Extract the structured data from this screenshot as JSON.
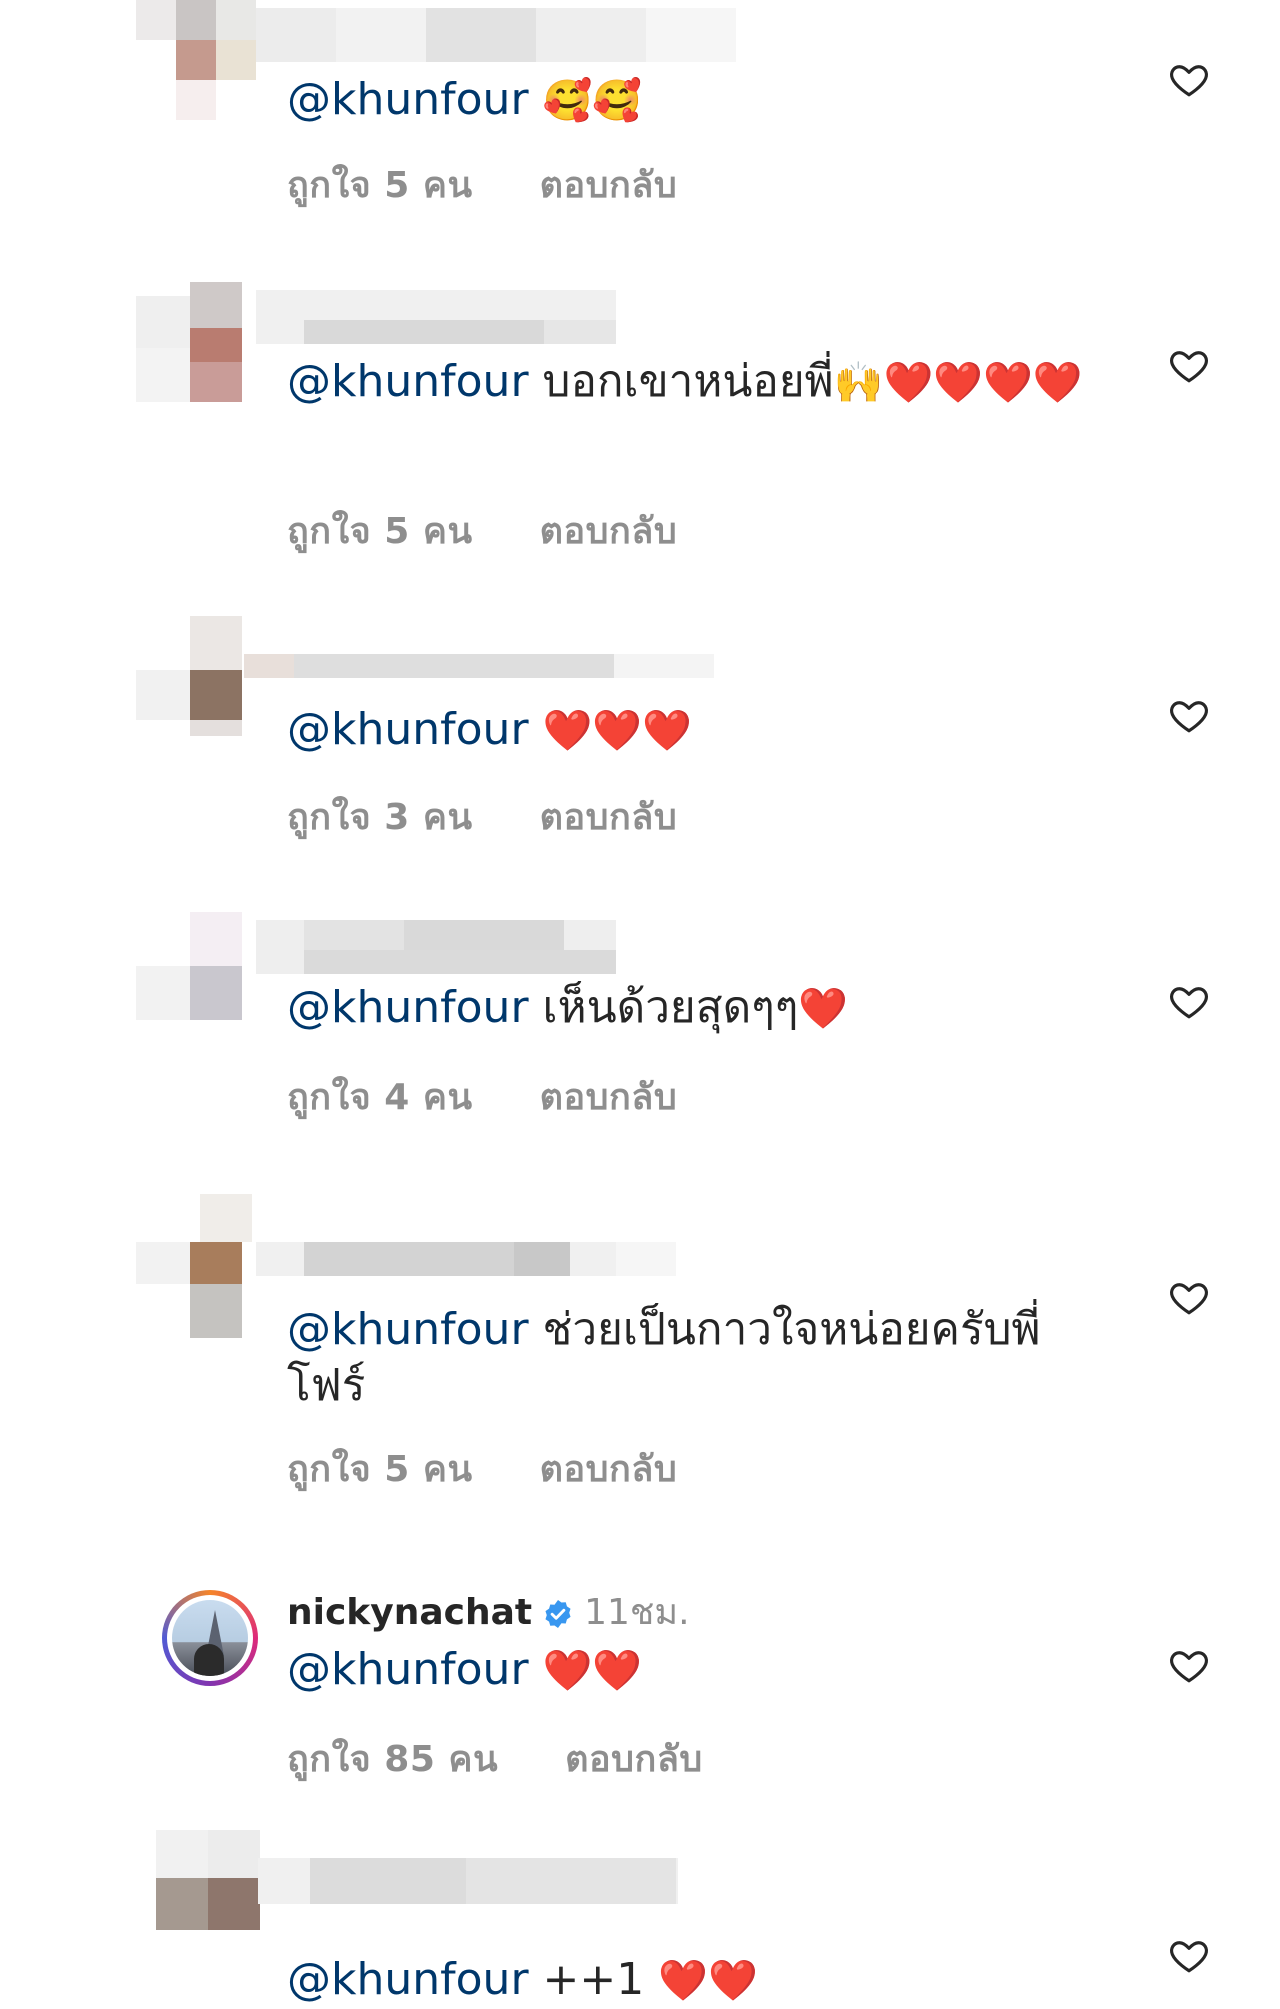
{
  "comments": [
    {
      "mention": "@khunfour",
      "text": "",
      "emoji": "🥰🥰",
      "likes": "ถูกใจ 5 คน",
      "reply": "ตอบกลับ"
    },
    {
      "mention": "@khunfour",
      "text": "บอกเขาหน่อยพี่",
      "emoji": "🙌❤️❤️❤️❤️",
      "likes": "ถูกใจ 5 คน",
      "reply": "ตอบกลับ"
    },
    {
      "mention": "@khunfour",
      "text": "",
      "emoji": "❤️❤️❤️",
      "likes": "ถูกใจ 3 คน",
      "reply": "ตอบกลับ"
    },
    {
      "mention": "@khunfour",
      "text": "เห็นด้วยสุดๆๆ",
      "emoji": "❤️",
      "likes": "ถูกใจ 4 คน",
      "reply": "ตอบกลับ"
    },
    {
      "mention": "@khunfour",
      "text": "ช่วยเป็นกาวใจหน่อยครับพี่โฟร์",
      "emoji": "",
      "likes": "ถูกใจ 5 คน",
      "reply": "ตอบกลับ"
    },
    {
      "username": "nickynachat",
      "time": "11ชม.",
      "mention": "@khunfour",
      "text": "",
      "emoji": "❤️❤️",
      "likes": "ถูกใจ 85 คน",
      "reply": "ตอบกลับ"
    },
    {
      "mention": "@khunfour",
      "text": "++1",
      "emoji": "❤️❤️",
      "likes": "",
      "reply": ""
    }
  ],
  "icons": {
    "like": "heart-outline-icon",
    "verified": "verified-badge-icon"
  },
  "colors": {
    "mention": "#00376b",
    "meta": "#8e8e8e",
    "verified": "#3897f0",
    "heart": "#ed1c3a"
  }
}
